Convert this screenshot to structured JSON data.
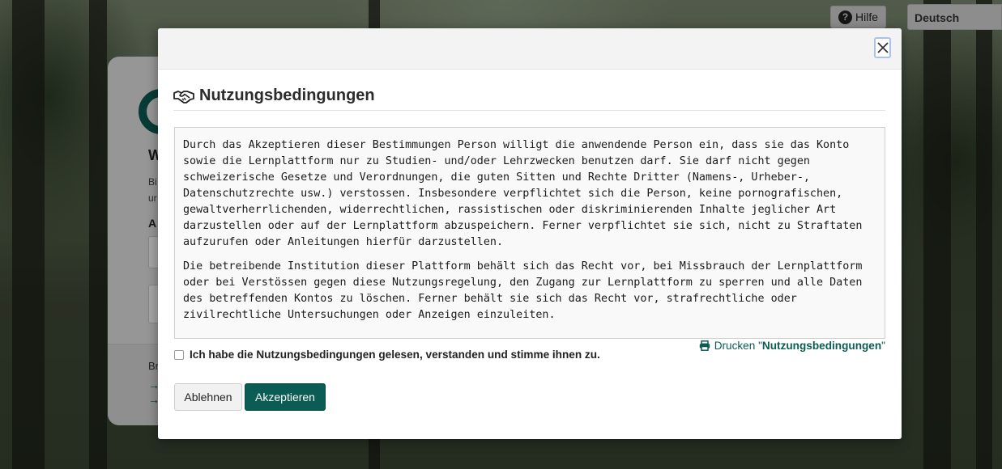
{
  "topbar": {
    "help_label": "Hilfe",
    "language_selected": "Deutsch"
  },
  "login_card": {
    "heading_fragment": "W",
    "text_line1_fragment": "Bi",
    "text_line2_fragment": "ur",
    "label_fragment": "A",
    "footer_fragment": "Br",
    "arrow1": "→",
    "arrow2": "→"
  },
  "modal": {
    "close_glyph": "✕",
    "title": "Nutzungsbedingungen",
    "terms_paragraphs": [
      "Durch das Akzeptieren dieser Bestimmungen Person willigt die anwendende Person ein, dass sie das Konto sowie die Lernplattform nur zu Studien- und/oder Lehrzwecken benutzen darf. Sie darf nicht gegen schweizerische Gesetze und Verordnungen, die guten Sitten und Rechte Dritter (Namens-, Urheber-, Datenschutzrechte usw.) verstossen. Insbesondere verpflichtet sich die Person, keine pornografischen, gewaltverherrlichenden, widerrechtlichen, rassistischen oder diskriminierenden Inhalte jeglicher Art darzustellen oder auf der Lernplattform abzuspeichern. Ferner verpflichtet sie sich, nicht zu Straftaten aufzurufen oder Anleitungen hierfür darzustellen.",
      "Die betreibende Institution dieser Plattform behält sich das Recht vor, bei Missbrauch der Lernplattform oder bei Verstössen gegen diese Nutzungsregelung, den Zugang zur Lernplattform zu sperren und alle Daten des betreffenden Kontos zu löschen. Ferner behält sie sich das Recht vor, strafrechtliche oder zivilrechtliche Untersuchungen oder Anzeigen einzuleiten."
    ],
    "accept_checkbox_label": "Ich habe die Nutzungsbedingungen gelesen, verstanden und stimme ihnen zu.",
    "print_prefix": "Drucken \"",
    "print_target": "Nutzungsbedingungen",
    "print_suffix": "\"",
    "decline_label": "Ablehnen",
    "accept_label": "Akzeptieren"
  },
  "colors": {
    "accent": "#0b5c54",
    "close_border": "#a9c3e4"
  },
  "icons": {
    "help": "question-circle-icon",
    "title": "handshake-icon",
    "print": "printer-icon",
    "close": "close-icon"
  }
}
